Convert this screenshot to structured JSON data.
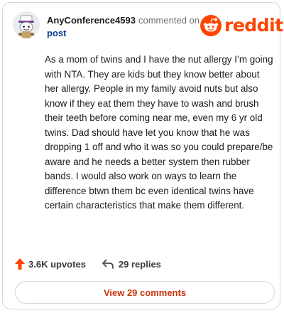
{
  "comment": {
    "username": "AnyConference4593",
    "commented_on_text": "commented on",
    "post_link_text": "post",
    "avatar_icon": "snoo-avatar-icon",
    "body": "As a mom of twins and I have the nut allergy I’m going with NTA. They are kids but they know better about her allergy. People in my family avoid nuts but also know if they eat them they have to wash and brush their teeth before coming near me, even my 6 yr old twins. Dad should have let you know that he was dropping 1 off and who it was so you could prepare/be aware and he needs a better system then rubber bands. I would also work on ways to learn the difference btwn them bc even identical twins have certain characteristics that make them different."
  },
  "brand": {
    "logo_text": "reddit",
    "logo_icon": "reddit-snoo-icon",
    "accent_color": "#ff4500"
  },
  "actions": {
    "upvotes_label": "3.6K upvotes",
    "upvote_icon": "upvote-arrow-icon",
    "upvote_color": "#ff4500",
    "replies_label": "29 replies",
    "reply_icon": "reply-arrow-icon"
  },
  "footer": {
    "view_comments_label": "View 29 comments",
    "button_text_color": "#c8330a"
  }
}
